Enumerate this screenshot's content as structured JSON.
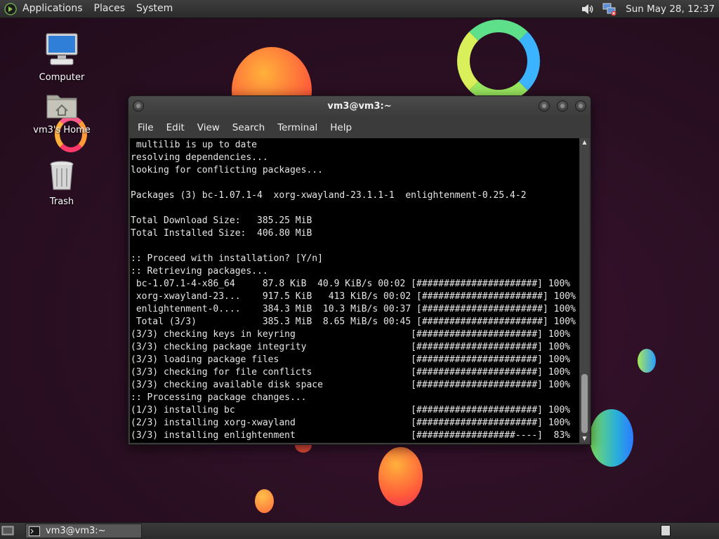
{
  "top_panel": {
    "menus": [
      "Applications",
      "Places",
      "System"
    ],
    "clock": "Sun May 28, 12:37"
  },
  "desktop_icons": [
    {
      "label": "Computer",
      "icon": "computer-icon"
    },
    {
      "label": "vm3's Home",
      "icon": "home-folder-icon"
    },
    {
      "label": "Trash",
      "icon": "trash-icon"
    }
  ],
  "terminal": {
    "title": "vm3@vm3:~",
    "menus": [
      "File",
      "Edit",
      "View",
      "Search",
      "Terminal",
      "Help"
    ],
    "lines": [
      " multilib is up to date",
      "resolving dependencies...",
      "looking for conflicting packages...",
      "",
      "Packages (3) bc-1.07.1-4  xorg-xwayland-23.1.1-1  enlightenment-0.25.4-2",
      "",
      "Total Download Size:   385.25 MiB",
      "Total Installed Size:  406.80 MiB",
      "",
      ":: Proceed with installation? [Y/n]",
      ":: Retrieving packages...",
      " bc-1.07.1-4-x86_64     87.8 KiB  40.9 KiB/s 00:02 [######################] 100%",
      " xorg-xwayland-23...    917.5 KiB   413 KiB/s 00:02 [######################] 100%",
      " enlightenment-0....    384.3 MiB  10.3 MiB/s 00:37 [######################] 100%",
      " Total (3/3)            385.3 MiB  8.65 MiB/s 00:45 [######################] 100%",
      "(3/3) checking keys in keyring                     [######################] 100%",
      "(3/3) checking package integrity                   [######################] 100%",
      "(3/3) loading package files                        [######################] 100%",
      "(3/3) checking for file conflicts                  [######################] 100%",
      "(3/3) checking available disk space                [######################] 100%",
      ":: Processing package changes...",
      "(1/3) installing bc                                [######################] 100%",
      "(2/3) installing xorg-xwayland                     [######################] 100%",
      "(3/3) installing enlightenment                     [##################----]  83%"
    ]
  },
  "taskbar": {
    "task_label": "vm3@vm3:~"
  },
  "colors": {
    "panel": "#2f2f2f",
    "terminal_bg": "#000000",
    "terminal_fg": "#e6e6e6"
  }
}
